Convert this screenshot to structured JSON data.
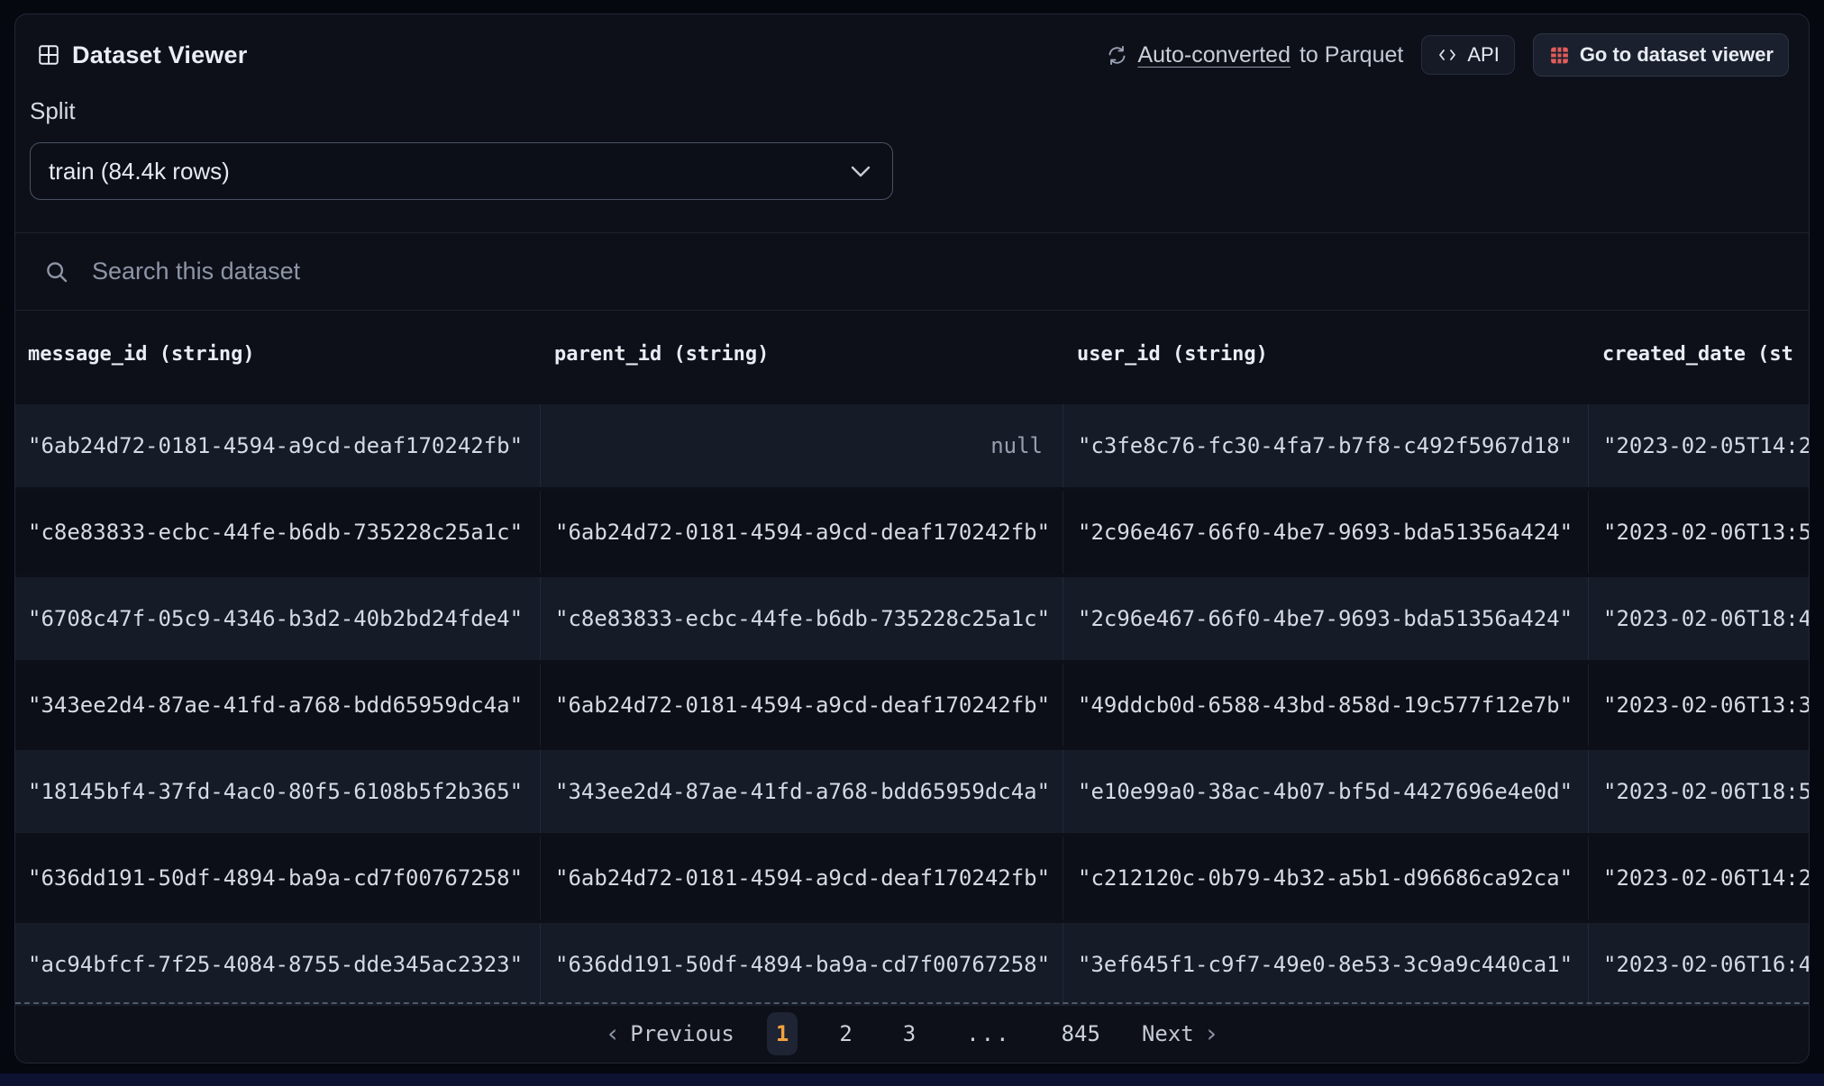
{
  "panel": {
    "title": "Dataset Viewer",
    "auto_converted_link": "Auto-converted",
    "auto_converted_suffix": "to Parquet",
    "api_label": "API",
    "goto_label": "Go to dataset viewer",
    "split_label": "Split",
    "split_value": "train (84.4k rows)",
    "search_placeholder": "Search this dataset"
  },
  "table": {
    "columns": [
      "message_id (string)",
      "parent_id (string)",
      "user_id (string)",
      "created_date (st"
    ],
    "rows": [
      {
        "cells": [
          "\"6ab24d72-0181-4594-a9cd-deaf170242fb\"",
          "null",
          "\"c3fe8c76-fc30-4fa7-b7f8-c492f5967d18\"",
          "\"2023-02-05T14:2"
        ]
      },
      {
        "cells": [
          "\"c8e83833-ecbc-44fe-b6db-735228c25a1c\"",
          "\"6ab24d72-0181-4594-a9cd-deaf170242fb\"",
          "\"2c96e467-66f0-4be7-9693-bda51356a424\"",
          "\"2023-02-06T13:5"
        ]
      },
      {
        "cells": [
          "\"6708c47f-05c9-4346-b3d2-40b2bd24fde4\"",
          "\"c8e83833-ecbc-44fe-b6db-735228c25a1c\"",
          "\"2c96e467-66f0-4be7-9693-bda51356a424\"",
          "\"2023-02-06T18:4"
        ]
      },
      {
        "cells": [
          "\"343ee2d4-87ae-41fd-a768-bdd65959dc4a\"",
          "\"6ab24d72-0181-4594-a9cd-deaf170242fb\"",
          "\"49ddcb0d-6588-43bd-858d-19c577f12e7b\"",
          "\"2023-02-06T13:3"
        ]
      },
      {
        "cells": [
          "\"18145bf4-37fd-4ac0-80f5-6108b5f2b365\"",
          "\"343ee2d4-87ae-41fd-a768-bdd65959dc4a\"",
          "\"e10e99a0-38ac-4b07-bf5d-4427696e4e0d\"",
          "\"2023-02-06T18:5"
        ]
      },
      {
        "cells": [
          "\"636dd191-50df-4894-ba9a-cd7f00767258\"",
          "\"6ab24d72-0181-4594-a9cd-deaf170242fb\"",
          "\"c212120c-0b79-4b32-a5b1-d96686ca92ca\"",
          "\"2023-02-06T14:2"
        ]
      },
      {
        "cells": [
          "\"ac94bfcf-7f25-4084-8755-dde345ac2323\"",
          "\"636dd191-50df-4894-ba9a-cd7f00767258\"",
          "\"3ef645f1-c9f7-49e0-8e53-3c9a9c440ca1\"",
          "\"2023-02-06T16:4"
        ]
      }
    ]
  },
  "pagination": {
    "previous_label": "Previous",
    "next_label": "Next",
    "pages": [
      "1",
      "2",
      "3",
      "...",
      "845"
    ],
    "current_page": "1"
  },
  "colors": {
    "accent_orange": "#f3a23d",
    "icon_red": "#e25d5d",
    "row_light": "#161b28",
    "row_dark": "#0c0f18",
    "panel_bg": "#0d1019"
  }
}
